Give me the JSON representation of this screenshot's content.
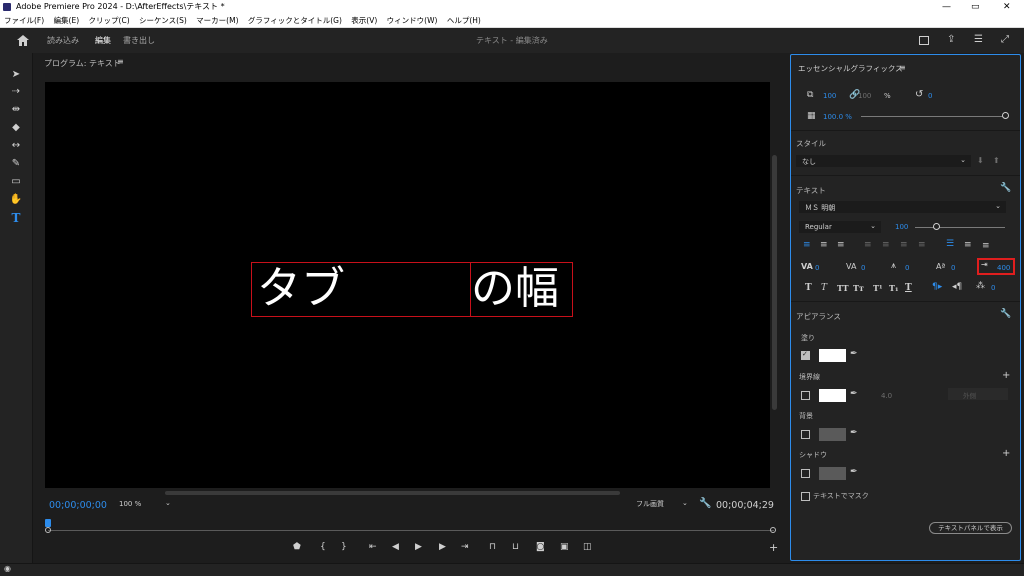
{
  "window": {
    "title": "Adobe Premiere Pro 2024 - D:\\AfterEffects\\テキスト *"
  },
  "menu": [
    "ファイル(F)",
    "編集(E)",
    "クリップ(C)",
    "シーケンス(S)",
    "マーカー(M)",
    "グラフィックとタイトル(G)",
    "表示(V)",
    "ウィンドウ(W)",
    "ヘルプ(H)"
  ],
  "workspace": {
    "tabs": [
      "読み込み",
      "編集",
      "書き出し"
    ],
    "active_tab": "編集",
    "project": "テキスト - 編集済み"
  },
  "monitor": {
    "title": "プログラム: テキスト",
    "text_left": "タブ",
    "text_right": "の幅",
    "timecode_in": "00;00;00;00",
    "zoom": "100 %",
    "quality": "フル画質",
    "timecode_out": "00;00;04;29"
  },
  "panel": {
    "title": "エッセンシャルグラフィックス",
    "scale": "100",
    "scale_linked": "100",
    "percent": "%",
    "rotation": "0",
    "opacity": "100.0 %",
    "style_label": "スタイル",
    "style_value": "なし",
    "text_label": "テキスト",
    "font": "ＭＳ 明朝",
    "font_style": "Regular",
    "font_size": "100",
    "kerning": "0",
    "tracking": "0",
    "leading": "0",
    "baseline": "0",
    "tab_width": "400",
    "tsume": "0",
    "appearance_label": "アピアランス",
    "fill_label": "塗り",
    "stroke_label": "境界線",
    "stroke_width": "4.0",
    "stroke_pos": "外側",
    "background_label": "背景",
    "shadow_label": "シャドウ",
    "mask_label": "テキストでマスク",
    "text_panel_button": "テキストパネルで表示"
  },
  "colors": {
    "accent": "#2d8ceb",
    "highlight": "#e01e1e",
    "selection_box": "#c8101a"
  }
}
